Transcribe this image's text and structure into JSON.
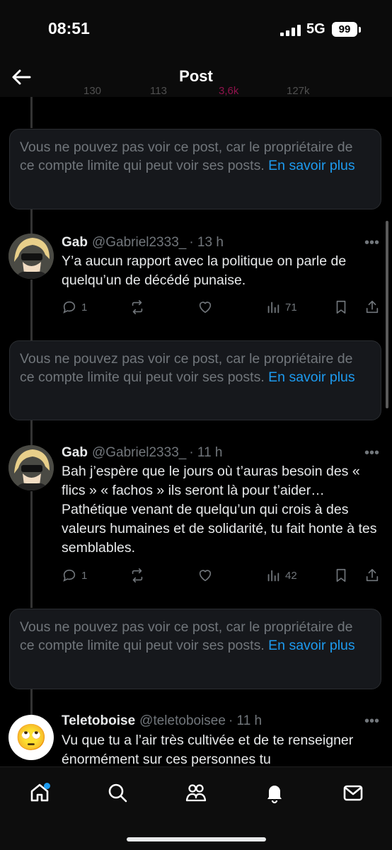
{
  "status": {
    "time": "08:51",
    "network": "5G",
    "battery": "99"
  },
  "header": {
    "title": "Post"
  },
  "peek": [
    "130",
    "113",
    "3,6k",
    "127k"
  ],
  "notice": {
    "text": "Vous ne pouvez pas voir ce post, car le propriétaire de ce compte limite qui peut voir ses posts.",
    "link": "En savoir plus"
  },
  "tweets": [
    {
      "name": "Gab",
      "handle": "@Gabriel2333_",
      "time": "· 13 h",
      "text": "Y’a aucun rapport avec la politique on parle de quelqu’un de décédé punaise.",
      "replies": "1",
      "views": "71"
    },
    {
      "name": "Gab",
      "handle": "@Gabriel2333_",
      "time": "· 11 h",
      "text": "Bah j’espère que le jours où t’auras besoin des « flics » « fachos » ils seront là pour t’aider… Pathétique venant de quelqu’un qui crois à des valeurs humaines et de solidarité, tu fait honte à tes semblables.",
      "replies": "1",
      "views": "42"
    },
    {
      "name": "Teletoboise",
      "handle": "@teletoboisee",
      "time": "· 11 h",
      "text": "Vu que tu a l’air très cultivée et de te renseigner énormément sur ces personnes tu",
      "avatar_emoji": "🙄"
    }
  ],
  "colors": {
    "accent": "#1d9bf0",
    "muted": "#71767b",
    "background": "#000000"
  },
  "icons": [
    "back-arrow-icon",
    "reply-icon",
    "repost-icon",
    "like-icon",
    "views-icon",
    "bookmark-icon",
    "share-icon",
    "home-icon",
    "search-icon",
    "communities-icon",
    "notifications-icon",
    "messages-icon"
  ]
}
